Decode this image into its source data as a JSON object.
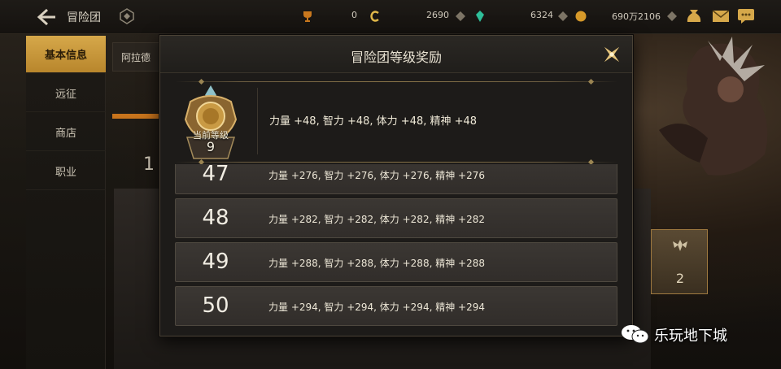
{
  "app": {
    "title": "冒险团"
  },
  "currencies": [
    {
      "icon": "trophy-icon",
      "value": "0"
    },
    {
      "icon": "coin-c-icon",
      "value": "2690"
    },
    {
      "icon": "crystal-icon",
      "value": "6324"
    },
    {
      "icon": "gold-icon",
      "value": "690万2106"
    }
  ],
  "sidebar": {
    "items": [
      {
        "label": "基本信息"
      },
      {
        "label": "远征"
      },
      {
        "label": "商店"
      },
      {
        "label": "职业"
      }
    ]
  },
  "background": {
    "subheader": "阿拉德",
    "frame_card_value": "2",
    "partial_number": "1"
  },
  "modal": {
    "title": "冒险团等级奖励",
    "current": {
      "label": "当前等级",
      "level": "9",
      "stats": "力量 +48, 智力 +48, 体力 +48, 精神 +48"
    },
    "rows": [
      {
        "level": "47",
        "stats": "力量 +276, 智力 +276, 体力 +276, 精神 +276"
      },
      {
        "level": "48",
        "stats": "力量 +282, 智力 +282, 体力 +282, 精神 +282"
      },
      {
        "level": "49",
        "stats": "力量 +288, 智力 +288, 体力 +288, 精神 +288"
      },
      {
        "level": "50",
        "stats": "力量 +294, 智力 +294, 体力 +294, 精神 +294"
      }
    ]
  },
  "watermark": {
    "text": "乐玩地下城"
  },
  "colors": {
    "accent_gold": "#d6a84a",
    "panel_bg": "#1d1b19",
    "row_bg": "#3b3733"
  }
}
